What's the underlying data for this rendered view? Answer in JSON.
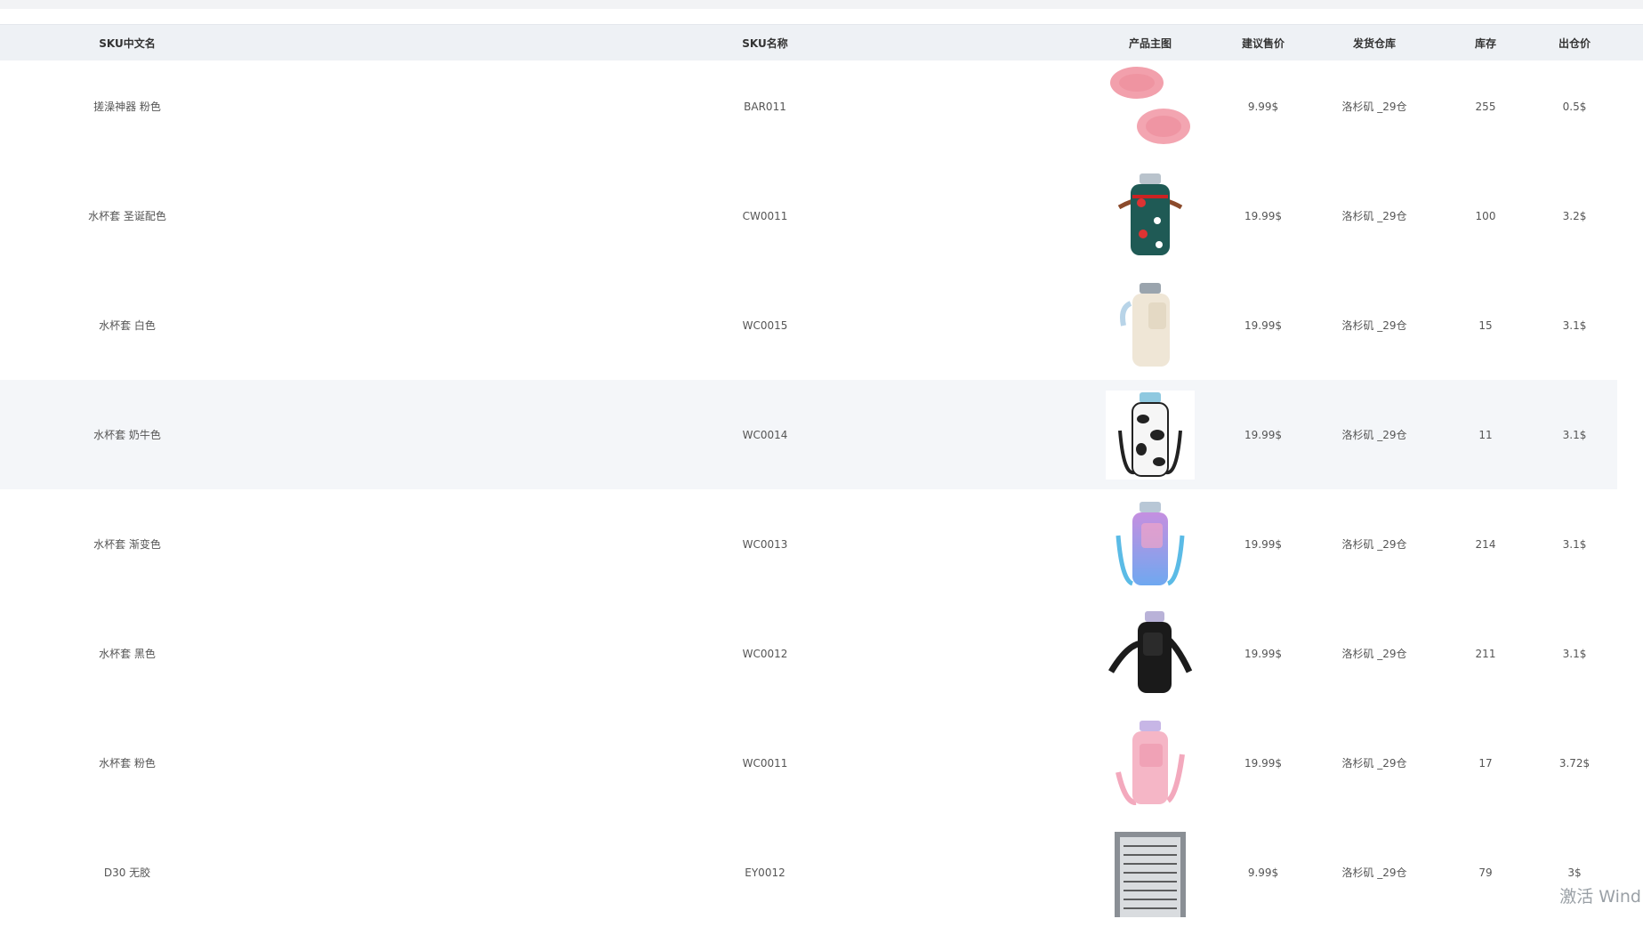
{
  "table": {
    "headers": {
      "cn_name": "SKU中文名",
      "sku": "SKU名称",
      "image": "产品主图",
      "price": "建议售价",
      "warehouse": "发货仓库",
      "stock": "库存",
      "out_price": "出仓价"
    },
    "rows": [
      {
        "cn_name": "搓澡神器 粉色",
        "sku": "BAR011",
        "price": "9.99$",
        "warehouse": "洛杉矶 _29仓",
        "stock": "255",
        "out_price": "0.5$",
        "image_icon": "pink-bath-scrubber-image"
      },
      {
        "cn_name": "水杯套 圣诞配色",
        "sku": "CW0011",
        "price": "19.99$",
        "warehouse": "洛杉矶 _29仓",
        "stock": "100",
        "out_price": "3.2$",
        "image_icon": "christmas-cup-sleeve-image"
      },
      {
        "cn_name": "水杯套 白色",
        "sku": "WC0015",
        "price": "19.99$",
        "warehouse": "洛杉矶 _29仓",
        "stock": "15",
        "out_price": "3.1$",
        "image_icon": "white-cup-sleeve-image"
      },
      {
        "cn_name": "水杯套 奶牛色",
        "sku": "WC0014",
        "price": "19.99$",
        "warehouse": "洛杉矶 _29仓",
        "stock": "11",
        "out_price": "3.1$",
        "image_icon": "cow-print-cup-sleeve-image"
      },
      {
        "cn_name": "水杯套 渐变色",
        "sku": "WC0013",
        "price": "19.99$",
        "warehouse": "洛杉矶 _29仓",
        "stock": "214",
        "out_price": "3.1$",
        "image_icon": "gradient-cup-sleeve-image"
      },
      {
        "cn_name": "水杯套 黑色",
        "sku": "WC0012",
        "price": "19.99$",
        "warehouse": "洛杉矶 _29仓",
        "stock": "211",
        "out_price": "3.1$",
        "image_icon": "black-cup-sleeve-image"
      },
      {
        "cn_name": "水杯套 粉色",
        "sku": "WC0011",
        "price": "19.99$",
        "warehouse": "洛杉矶 _29仓",
        "stock": "17",
        "out_price": "3.72$",
        "image_icon": "pink-cup-sleeve-image"
      },
      {
        "cn_name": "D30 无胶",
        "sku": "EY0012",
        "price": "9.99$",
        "warehouse": "洛杉矶 _29仓",
        "stock": "79",
        "out_price": "3$",
        "image_icon": "eyelash-tray-image"
      }
    ]
  },
  "watermark": "激活 Wind",
  "colors": {
    "header_bg": "#eef1f5",
    "hover_row_bg": "#f4f6f9"
  }
}
